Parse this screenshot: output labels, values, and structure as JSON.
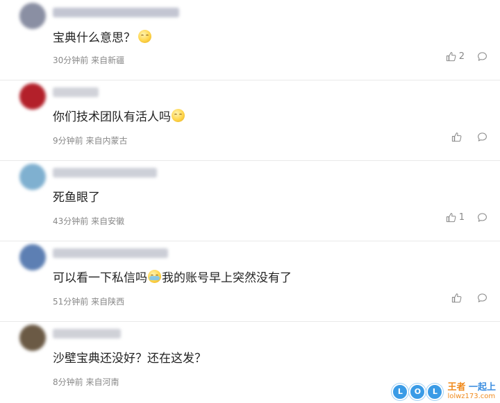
{
  "comments": [
    {
      "text_before": "宝典什么意思？",
      "emoji": "smirk-emoji",
      "text_after": "",
      "time": "30分钟前",
      "location": "来自新疆",
      "likes": "2",
      "avatar_color": "#8a8fa3",
      "username_color": "#b9bccb"
    },
    {
      "text_before": "你们技术团队有活人吗",
      "emoji": "smirk-emoji",
      "text_after": "",
      "time": "9分钟前",
      "location": "来自内蒙古",
      "likes": "",
      "avatar_color": "#b3202a",
      "username_color": "#c9cbd3"
    },
    {
      "text_before": "死鱼眼了",
      "emoji": "",
      "text_after": "",
      "time": "43分钟前",
      "location": "来自安徽",
      "likes": "1",
      "avatar_color": "#7fb0d0",
      "username_color": "#c5c8d2"
    },
    {
      "text_before": "可以看一下私信吗",
      "emoji": "cry-emoji",
      "text_after": "我的账号早上突然没有了",
      "time": "51分钟前",
      "location": "来自陕西",
      "likes": "",
      "avatar_color": "#5d7fb3",
      "username_color": "#c3c6d0"
    },
    {
      "text_before": "沙壁宝典还没好？还在这发？",
      "emoji": "",
      "text_after": "",
      "time": "8分钟前",
      "location": "来自河南",
      "likes": "",
      "avatar_color": "#6b5a45",
      "username_color": "#c7c9d1"
    }
  ],
  "watermark": {
    "logo_letters": [
      "L",
      "O",
      "L"
    ],
    "title_prefix": "王者",
    "title_suffix": "一起上",
    "url": "lolwz173.com"
  }
}
